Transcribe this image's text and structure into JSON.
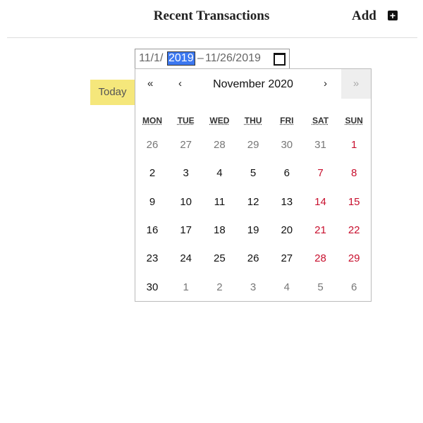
{
  "header": {
    "title": "Recent Transactions",
    "add_label": "Add",
    "add_icon": "plus-square-icon"
  },
  "today_label": "Today",
  "range": {
    "start_prefix": "11/1/",
    "start_year": "2019",
    "separator": "–",
    "end": "11/26/2019"
  },
  "calendar": {
    "month_label": "November 2020",
    "prev_year": "«",
    "prev_month": "‹",
    "next_month": "›",
    "next_year": "»",
    "weekdays": [
      "MON",
      "TUE",
      "WED",
      "THU",
      "FRI",
      "SAT",
      "SUN"
    ],
    "weeks": [
      [
        [
          "26",
          "o"
        ],
        [
          "27",
          "o"
        ],
        [
          "28",
          "o"
        ],
        [
          "29",
          "o"
        ],
        [
          "30",
          "o"
        ],
        [
          "31",
          "o"
        ],
        [
          "1",
          "w"
        ]
      ],
      [
        [
          "2",
          "n"
        ],
        [
          "3",
          "n"
        ],
        [
          "4",
          "n"
        ],
        [
          "5",
          "n"
        ],
        [
          "6",
          "n"
        ],
        [
          "7",
          "w"
        ],
        [
          "8",
          "w"
        ]
      ],
      [
        [
          "9",
          "n"
        ],
        [
          "10",
          "n"
        ],
        [
          "11",
          "n"
        ],
        [
          "12",
          "n"
        ],
        [
          "13",
          "n"
        ],
        [
          "14",
          "w"
        ],
        [
          "15",
          "w"
        ]
      ],
      [
        [
          "16",
          "n"
        ],
        [
          "17",
          "n"
        ],
        [
          "18",
          "n"
        ],
        [
          "19",
          "n"
        ],
        [
          "20",
          "n"
        ],
        [
          "21",
          "w"
        ],
        [
          "22",
          "w"
        ]
      ],
      [
        [
          "23",
          "n"
        ],
        [
          "24",
          "n"
        ],
        [
          "25",
          "n"
        ],
        [
          "26",
          "n"
        ],
        [
          "27",
          "n"
        ],
        [
          "28",
          "w"
        ],
        [
          "29",
          "w"
        ]
      ],
      [
        [
          "30",
          "n"
        ],
        [
          "1",
          "o"
        ],
        [
          "2",
          "o"
        ],
        [
          "3",
          "o"
        ],
        [
          "4",
          "o"
        ],
        [
          "5",
          "o"
        ],
        [
          "6",
          "o"
        ]
      ]
    ]
  }
}
